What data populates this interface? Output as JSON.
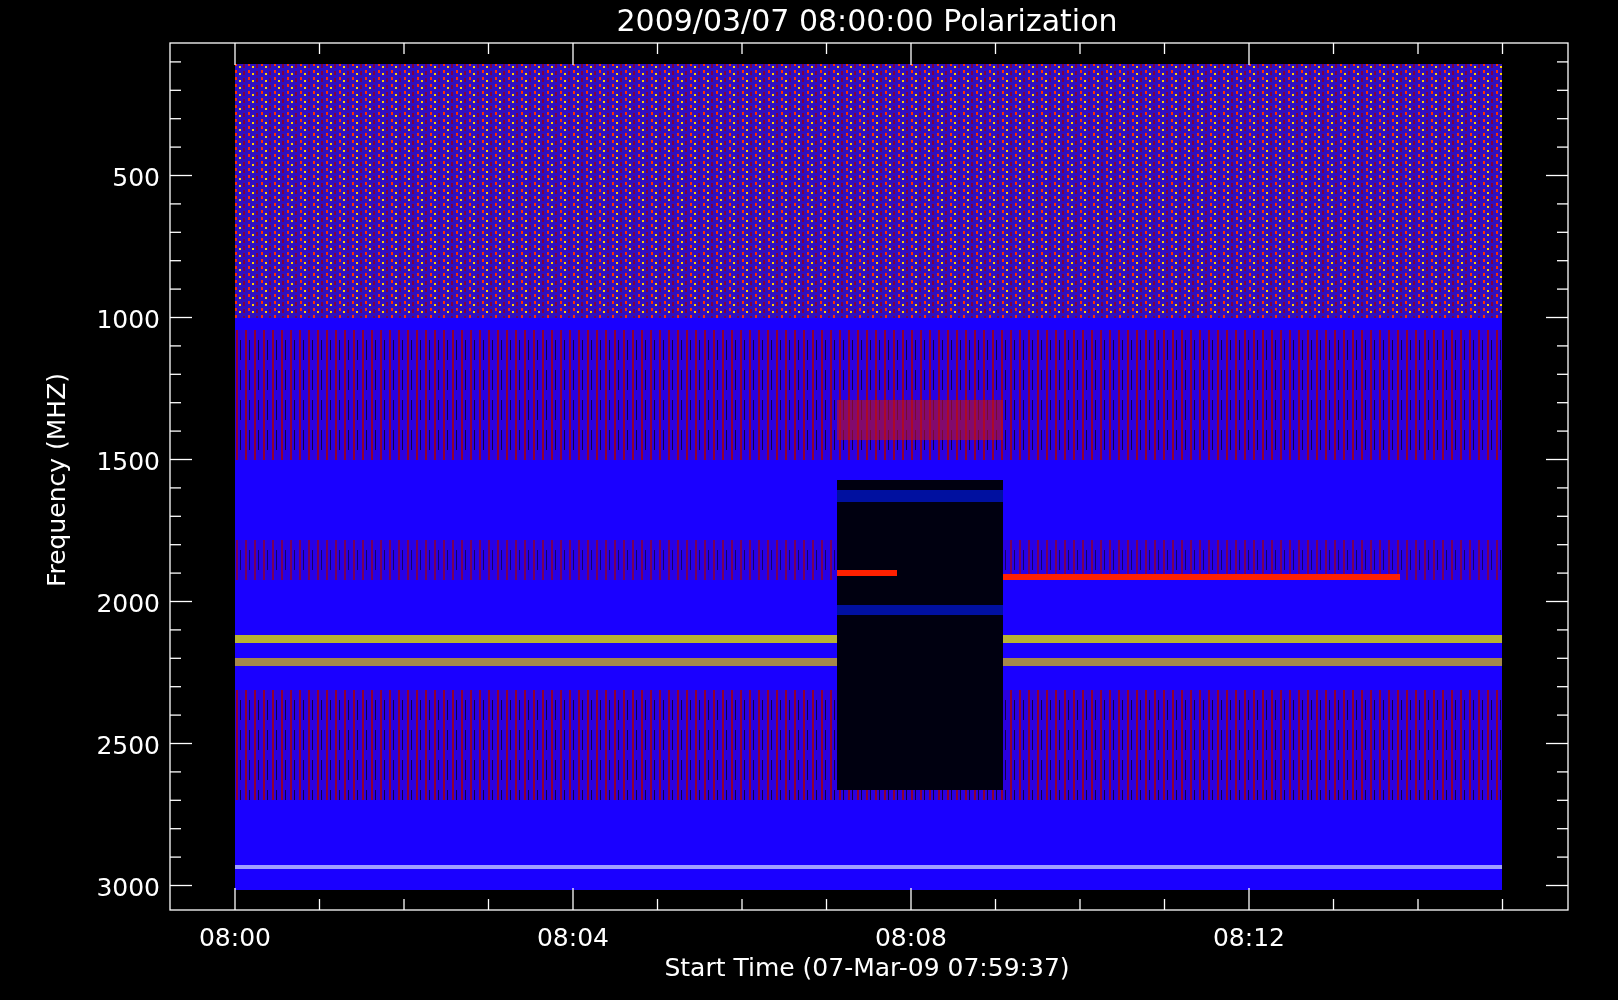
{
  "title": "2009/03/07 08:00:00 Polarization",
  "y_axis": {
    "label": "Frequency (MHZ)",
    "ticks": [
      "500",
      "1000",
      "1500",
      "2000",
      "2500",
      "3000"
    ]
  },
  "x_axis": {
    "label": "Start Time (07-Mar-09 07:59:37)",
    "ticks": [
      "08:00",
      "08:04",
      "08:08",
      "08:12"
    ]
  }
}
